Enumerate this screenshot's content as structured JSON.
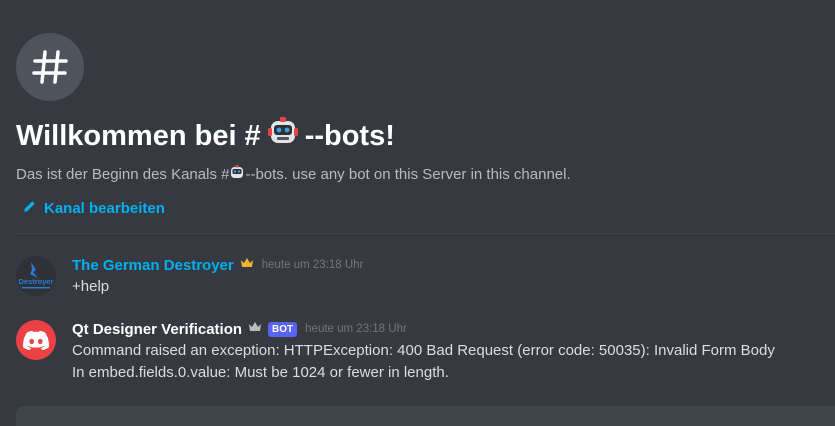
{
  "welcome": {
    "hash_glyph": "#",
    "title_prefix": "Willkommen bei #",
    "title_suffix": "--bots!",
    "description_prefix": "Das ist der Beginn des Kanals #",
    "description_suffix": "--bots. use any bot on this Server in this channel.",
    "edit_label": "Kanal bearbeiten"
  },
  "messages": [
    {
      "username": "The German Destroyer",
      "username_color": "#00b0f4",
      "timestamp": "heute um 23:18 Uhr",
      "lines": [
        "+help"
      ],
      "avatar_text": "Destroyer"
    },
    {
      "username": "Qt Designer Verification",
      "username_color": "#ffffff",
      "badge": "BOT",
      "timestamp": "heute um 23:18 Uhr",
      "lines": [
        "Command raised an exception: HTTPException: 400 Bad Request (error code: 50035): Invalid Form Body",
        "In embed.fields.0.value: Must be 1024 or fewer in length."
      ],
      "avatar_color": "#ed4245"
    }
  ],
  "colors": {
    "background": "#36393f",
    "link": "#00b0f4",
    "crown_gold": "#f0b232",
    "crown_gray": "#b9bbbe",
    "bot_badge": "#5865f2"
  }
}
